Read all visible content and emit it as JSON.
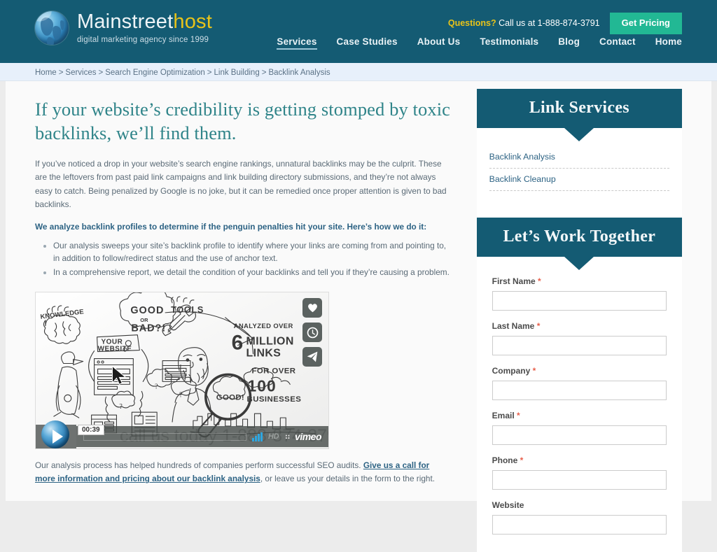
{
  "header": {
    "logo": {
      "icon": "globe-icon",
      "main_part1": "Mainstreet",
      "main_part2": "host",
      "tagline": "digital marketing agency since 1999"
    },
    "questions_label": "Questions?",
    "questions_text": "Call us at 1-888-874-3791",
    "get_pricing_label": "Get Pricing",
    "nav": [
      {
        "label": "Services",
        "active": true
      },
      {
        "label": "Case Studies",
        "active": false
      },
      {
        "label": "About Us",
        "active": false
      },
      {
        "label": "Testimonials",
        "active": false
      },
      {
        "label": "Blog",
        "active": false
      },
      {
        "label": "Contact",
        "active": false
      },
      {
        "label": "Home",
        "active": false
      }
    ],
    "accent_color": "#22b894",
    "brand_color": "#145b73",
    "highlight_color": "#e8c31a"
  },
  "breadcrumb": {
    "separator": ">",
    "items": [
      "Home",
      "Services",
      "Search Engine Optimization",
      "Link Building",
      "Backlink Analysis"
    ]
  },
  "main": {
    "headline": "If your website’s credibility is getting stomped by toxic backlinks, we’ll find them.",
    "intro": "If you’ve noticed a drop in your website’s search engine rankings, unnatural backlinks may be the culprit. These are the leftovers from past paid link campaigns and link building directory submissions, and they’re not always easy to catch. Being penalized by Google is no joke, but it can be remedied once proper attention is given to bad backlinks.",
    "lead": "We analyze backlink profiles to determine if the penguin penalties hit your site. Here’s how we do it:",
    "bullets": [
      "Our analysis sweeps your site’s backlink profile to identify where your links are coming from and pointing to, in addition to follow/redirect status and the use of anchor text.",
      "In a comprehensive report, we detail the condition of your backlinks and tell you if they’re causing a problem."
    ],
    "closing_before": "Our analysis process has helped hundreds of companies perform successful SEO audits. ",
    "closing_link": "Give us a call for more information and pricing about our backlink analysis",
    "closing_after": ", or leave us your details in the form to the right."
  },
  "video": {
    "time": "00:39",
    "overlay_text": "call us today   1-888-874-3791",
    "brand": "vimeo",
    "quality_label": "HD",
    "icons": [
      "heart-icon",
      "clock-icon",
      "share-icon"
    ],
    "whiteboard_labels": {
      "knowledge": "KNOWLEDGE",
      "good_or_bad": "GOOD",
      "good_or_bad2": "OR",
      "good_or_bad3": "BAD?!",
      "tools": "TOOLS",
      "your_website": "YOUR WEBSITE",
      "analyzed_over": "ANALYZED OVER",
      "six": "6",
      "million": "MILLION",
      "links": "LINKS",
      "for_over": "FOR OVER",
      "hundred": "100",
      "businesses": "BUSINESSES",
      "good_bubble": "GOOD!"
    }
  },
  "sidebar": {
    "services_panel": {
      "title": "Link Services",
      "items": [
        {
          "label": "Backlink Analysis"
        },
        {
          "label": "Backlink Cleanup"
        }
      ]
    },
    "form_panel": {
      "title": "Let’s Work Together",
      "required_marker": "*",
      "fields": [
        {
          "label": "First Name",
          "required": true,
          "value": "",
          "placeholder": ""
        },
        {
          "label": "Last Name",
          "required": true,
          "value": "",
          "placeholder": ""
        },
        {
          "label": "Company",
          "required": true,
          "value": "",
          "placeholder": ""
        },
        {
          "label": "Email",
          "required": true,
          "value": "",
          "placeholder": ""
        },
        {
          "label": "Phone",
          "required": true,
          "value": "",
          "placeholder": ""
        },
        {
          "label": "Website",
          "required": false,
          "value": "",
          "placeholder": ""
        }
      ]
    }
  }
}
